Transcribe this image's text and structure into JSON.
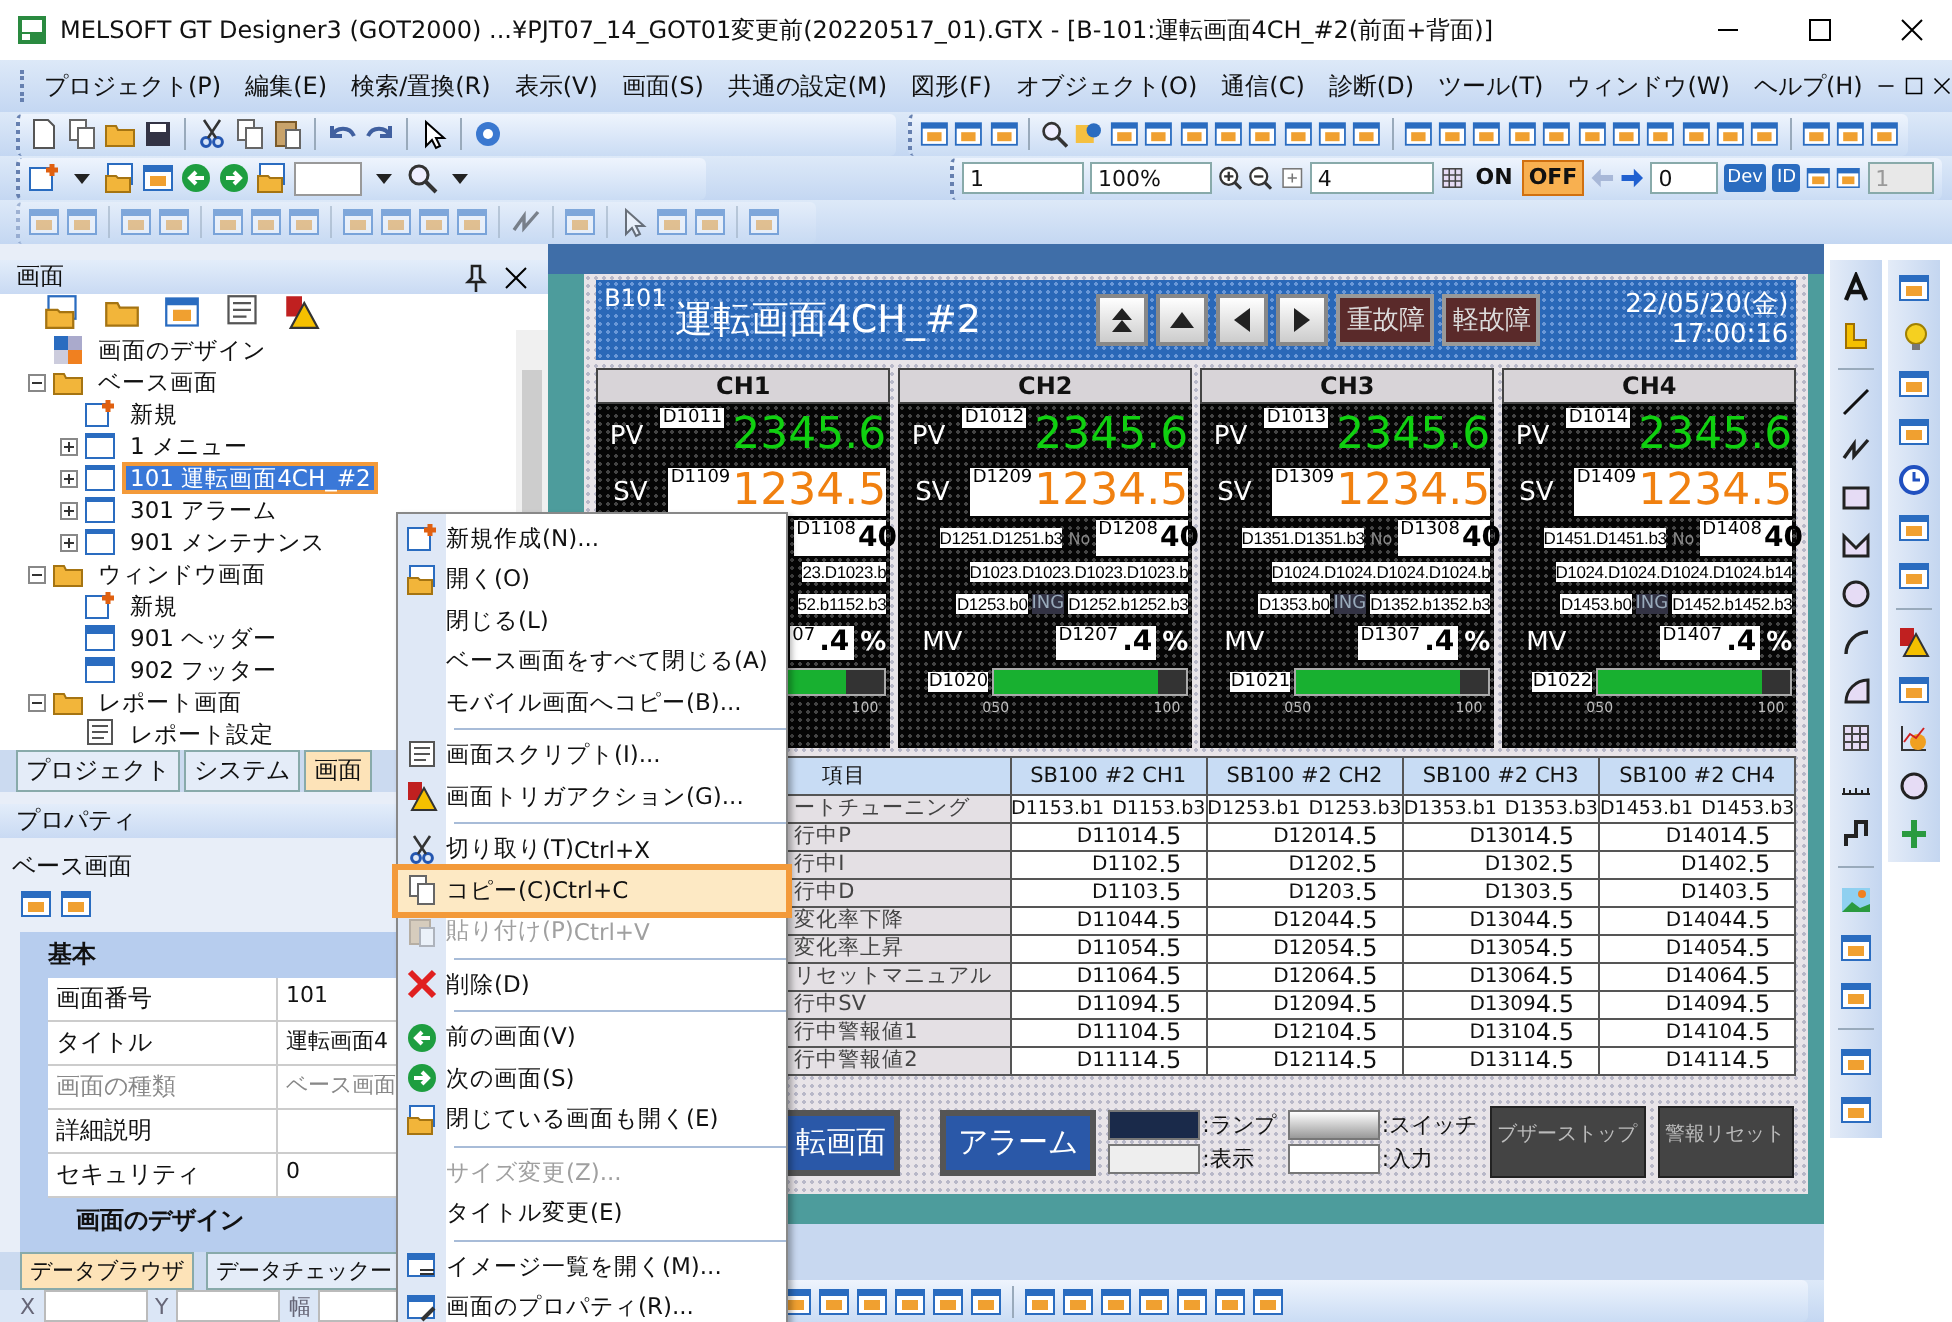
{
  "window": {
    "title": "MELSOFT GT Designer3 (GOT2000) ...¥PJT07_14_GOT01変更前(20220517_01).GTX - [B-101:運転画面4CH_#2(前面+背面)]"
  },
  "menu_bar": [
    "プロジェクト(P)",
    "編集(E)",
    "検索/置換(R)",
    "表示(V)",
    "画面(S)",
    "共通の設定(M)",
    "図形(F)",
    "オブジェクト(O)",
    "通信(C)",
    "診断(D)",
    "ツール(T)",
    "ウィンドウ(W)",
    "ヘルプ(H)"
  ],
  "toolbar_fields": [
    {
      "value": "1",
      "disabled": false
    },
    {
      "value": "100%",
      "disabled": false
    },
    {
      "value": "4",
      "disabled": false
    },
    {
      "value": "0",
      "disabled": false
    },
    {
      "value": "1",
      "disabled": true
    }
  ],
  "toolbar_toggles": [
    {
      "label": "ON",
      "on": false
    },
    {
      "label": "OFF",
      "on": true
    }
  ],
  "toolbar_labels": [
    "Dev",
    "ID"
  ],
  "screen_panel": {
    "title": "画面",
    "tree": [
      {
        "label": "画面のデザイン",
        "kind": "design",
        "selected": false
      },
      {
        "label": "ベース画面",
        "kind": "folder",
        "expanded": true,
        "selected": false,
        "children": [
          {
            "label": "新規",
            "kind": "new",
            "selected": false
          },
          {
            "label": "1 メニュー",
            "kind": "screen",
            "expanded": false,
            "selected": false
          },
          {
            "label": "101 運転画面4CH_#2",
            "kind": "screen",
            "expanded": false,
            "selected": true
          },
          {
            "label": "301 アラーム",
            "kind": "screen",
            "expanded": false,
            "selected": false
          },
          {
            "label": "901 メンテナンス",
            "kind": "screen",
            "expanded": false,
            "selected": false
          }
        ]
      },
      {
        "label": "ウィンドウ画面",
        "kind": "folder",
        "expanded": true,
        "selected": false,
        "children": [
          {
            "label": "新規",
            "kind": "new",
            "selected": false
          },
          {
            "label": "901 ヘッダー",
            "kind": "window",
            "selected": false
          },
          {
            "label": "902 フッター",
            "kind": "window",
            "selected": false
          }
        ]
      },
      {
        "label": "レポート画面",
        "kind": "folder",
        "expanded": true,
        "selected": false,
        "children": [
          {
            "label": "レポート設定",
            "kind": "report",
            "selected": false
          }
        ]
      }
    ],
    "tabs": [
      {
        "label": "プロジェクト",
        "selected": false
      },
      {
        "label": "システム",
        "selected": false
      },
      {
        "label": "画面",
        "selected": true
      }
    ]
  },
  "properties": {
    "title": "プロパティ",
    "object": "ベース画面",
    "section": "基本",
    "rows": [
      {
        "name": "画面番号",
        "value": "101",
        "disabled": false
      },
      {
        "name": "タイトル",
        "value": "運転画面4",
        "disabled": false
      },
      {
        "name": "画面の種類",
        "value": "ベース画面",
        "disabled": true
      },
      {
        "name": "詳細説明",
        "disabled": false
      },
      {
        "name": "セキュリティ",
        "value": "0",
        "disabled": false
      }
    ],
    "subsection": "画面のデザイン"
  },
  "bottom_tabs": [
    {
      "label": "データブラウザ",
      "selected": true
    },
    {
      "label": "データチェックー",
      "selected": false
    }
  ],
  "coordinates": [
    "X",
    "Y",
    "幅"
  ],
  "hmi": {
    "id": "B101",
    "title": "運転画面4CH_#2",
    "alarm_buttons": [
      "重故障",
      "軽故障"
    ],
    "date": "22/05/20(金)",
    "time": "17:00:16",
    "channels": [
      {
        "name": "CH1",
        "pv_label": "PV",
        "pv_device": "D1011",
        "pv_value": "2345.6",
        "sv_label": "SV",
        "sv_device": "D1109",
        "sv_value": "1234.5",
        "step_device": "D1108",
        "step_value": "40",
        "row4": "23.D1023.b",
        "bit_right": "52.b1152.b3",
        "mv_device": "07",
        "mv_value": ".4",
        "mv_unit": "%",
        "level": 0.8,
        "scale": [
          "100"
        ]
      },
      {
        "name": "CH2",
        "pv_label": "PV",
        "pv_device": "D1012",
        "pv_value": "2345.6",
        "sv_label": "SV",
        "sv_device": "D1209",
        "sv_value": "1234.5",
        "bits": "D1251.D1251.b3",
        "no_label": "No",
        "step_device": "D1208",
        "step_value": "40",
        "row4": "D1023.D1023.D1023.D1023.b",
        "bit_left": "D1253.b0",
        "ing": "ING",
        "bit_right": "D1252.b1252.b3",
        "mv_label": "MV",
        "mv_device": "D1207",
        "mv_value": ".4",
        "mv_unit": "%",
        "bar_device": "D1020",
        "level": 0.85,
        "scale": [
          "0",
          "50",
          "100"
        ]
      },
      {
        "name": "CH3",
        "pv_label": "PV",
        "pv_device": "D1013",
        "pv_value": "2345.6",
        "sv_label": "SV",
        "sv_device": "D1309",
        "sv_value": "1234.5",
        "bits": "D1351.D1351.b3",
        "no_label": "No",
        "step_device": "D1308",
        "step_value": "40",
        "row4": "D1024.D1024.D1024.D1024.b",
        "bit_left": "D1353.b0",
        "ing": "ING",
        "bit_right": "D1352.b1352.b3",
        "mv_label": "MV",
        "mv_device": "D1307",
        "mv_value": ".4",
        "mv_unit": "%",
        "bar_device": "D1021",
        "level": 0.85,
        "scale": [
          "0",
          "50",
          "100"
        ]
      },
      {
        "name": "CH4",
        "pv_label": "PV",
        "pv_device": "D1014",
        "pv_value": "2345.6",
        "sv_label": "SV",
        "sv_device": "D1409",
        "sv_value": "1234.5",
        "bits": "D1451.D1451.b3",
        "no_label": "No",
        "step_device": "D1408",
        "step_value": "40",
        "row4": "D1024.D1024.D1024.D1024.b14",
        "bit_left": "D1453.b0",
        "ing": "ING",
        "bit_right": "D1452.b1452.b3",
        "mv_label": "MV",
        "mv_device": "D1407",
        "mv_value": ".4",
        "mv_unit": "%",
        "bar_device": "D1022",
        "level": 0.85,
        "scale": [
          "0",
          "50",
          "100"
        ]
      }
    ],
    "table": {
      "label_header": "項目",
      "columns": [
        "SB100 #2 CH1",
        "SB100 #2 CH2",
        "SB100 #2 CH3",
        "SB100 #2 CH4"
      ],
      "rows": [
        {
          "label": "ートチューニング",
          "kind": "bits",
          "cells": [
            [
              "D1153.b1",
              "D1153.b3"
            ],
            [
              "D1253.b1",
              "D1253.b3"
            ],
            [
              "D1353.b1",
              "D1353.b3"
            ],
            [
              "D1453.b1",
              "D1453.b3"
            ]
          ]
        },
        {
          "label": "行中P",
          "kind": "value",
          "cells": [
            {
              "device": "D1101",
              "value": "4.5"
            },
            {
              "device": "D1201",
              "value": "4.5"
            },
            {
              "device": "D1301",
              "value": "4.5"
            },
            {
              "device": "D1401",
              "value": "4.5"
            }
          ]
        },
        {
          "label": "行中I",
          "kind": "value",
          "cells": [
            {
              "device": "D1102",
              "value": ".5"
            },
            {
              "device": "D1202",
              "value": ".5"
            },
            {
              "device": "D1302",
              "value": ".5"
            },
            {
              "device": "D1402",
              "value": ".5"
            }
          ]
        },
        {
          "label": "行中D",
          "kind": "value",
          "cells": [
            {
              "device": "D1103",
              "value": ".5"
            },
            {
              "device": "D1203",
              "value": ".5"
            },
            {
              "device": "D1303",
              "value": ".5"
            },
            {
              "device": "D1403",
              "value": ".5"
            }
          ]
        },
        {
          "label": "変化率下降",
          "kind": "value",
          "cells": [
            {
              "device": "D1104",
              "value": "4.5"
            },
            {
              "device": "D1204",
              "value": "4.5"
            },
            {
              "device": "D1304",
              "value": "4.5"
            },
            {
              "device": "D1404",
              "value": "4.5"
            }
          ]
        },
        {
          "label": "変化率上昇",
          "kind": "value",
          "cells": [
            {
              "device": "D1105",
              "value": "4.5"
            },
            {
              "device": "D1205",
              "value": "4.5"
            },
            {
              "device": "D1305",
              "value": "4.5"
            },
            {
              "device": "D1405",
              "value": "4.5"
            }
          ]
        },
        {
          "label": "リセットマニュアル",
          "kind": "value",
          "cells": [
            {
              "device": "D1106",
              "value": "4.5"
            },
            {
              "device": "D1206",
              "value": "4.5"
            },
            {
              "device": "D1306",
              "value": "4.5"
            },
            {
              "device": "D1406",
              "value": "4.5"
            }
          ]
        },
        {
          "label": "行中SV",
          "kind": "value",
          "cells": [
            {
              "device": "D1109",
              "value": "4.5"
            },
            {
              "device": "D1209",
              "value": "4.5"
            },
            {
              "device": "D1309",
              "value": "4.5"
            },
            {
              "device": "D1409",
              "value": "4.5"
            }
          ]
        },
        {
          "label": "行中警報値1",
          "kind": "value",
          "cells": [
            {
              "device": "D1110",
              "value": "4.5"
            },
            {
              "device": "D1210",
              "value": "4.5"
            },
            {
              "device": "D1310",
              "value": "4.5"
            },
            {
              "device": "D1410",
              "value": "4.5"
            }
          ]
        },
        {
          "label": "行中警報値2",
          "kind": "value",
          "cells": [
            {
              "device": "D1111",
              "value": "4.5"
            },
            {
              "device": "D1211",
              "value": "4.5"
            },
            {
              "device": "D1311",
              "value": "4.5"
            },
            {
              "device": "D1411",
              "value": "4.5"
            }
          ]
        }
      ]
    },
    "footer": {
      "nav_button": "転画面",
      "alarm_button": "アラーム",
      "legend": [
        {
          "kind": "lamp",
          "label": ":ランプ"
        },
        {
          "kind": "switch",
          "label": ":スイッチ"
        },
        {
          "kind": "display",
          "label": ":表示"
        },
        {
          "kind": "input",
          "label": ":入力"
        }
      ],
      "dim_buttons": [
        "ブザーストップ",
        "警報リセット"
      ]
    }
  },
  "context_menu": [
    {
      "kind": "item",
      "label": "新規作成(N)...",
      "disabled": false,
      "selected": false
    },
    {
      "kind": "item",
      "label": "開く(O)",
      "disabled": false,
      "selected": false
    },
    {
      "kind": "item",
      "label": "閉じる(L)",
      "disabled": false,
      "selected": false
    },
    {
      "kind": "item",
      "label": "ベース画面をすべて閉じる(A)",
      "disabled": false,
      "selected": false
    },
    {
      "kind": "item",
      "label": "モバイル画面へコピー(B)...",
      "disabled": false,
      "selected": false
    },
    {
      "kind": "separator"
    },
    {
      "kind": "item",
      "label": "画面スクリプト(I)...",
      "disabled": false,
      "selected": false
    },
    {
      "kind": "item",
      "label": "画面トリガアクション(G)...",
      "disabled": false,
      "selected": false
    },
    {
      "kind": "separator"
    },
    {
      "kind": "item",
      "label": "切り取り(T)",
      "shortcut": "Ctrl+X",
      "disabled": false,
      "selected": false
    },
    {
      "kind": "item",
      "label": "コピー(C)",
      "shortcut": "Ctrl+C",
      "disabled": false,
      "selected": true
    },
    {
      "kind": "item",
      "label": "貼り付け(P)",
      "shortcut": "Ctrl+V",
      "disabled": true,
      "selected": false
    },
    {
      "kind": "separator"
    },
    {
      "kind": "item",
      "label": "削除(D)",
      "disabled": false,
      "selected": false
    },
    {
      "kind": "separator"
    },
    {
      "kind": "item",
      "label": "前の画面(V)",
      "disabled": false,
      "selected": false
    },
    {
      "kind": "item",
      "label": "次の画面(S)",
      "disabled": false,
      "selected": false
    },
    {
      "kind": "item",
      "label": "閉じている画面も開く(E)",
      "disabled": false,
      "selected": false
    },
    {
      "kind": "separator"
    },
    {
      "kind": "item",
      "label": "サイズ変更(Z)...",
      "disabled": true,
      "selected": false
    },
    {
      "kind": "item",
      "label": "タイトル変更(E)",
      "disabled": false,
      "selected": false
    },
    {
      "kind": "separator"
    },
    {
      "kind": "item",
      "label": "イメージ一覧を開く(M)...",
      "disabled": false,
      "selected": false
    },
    {
      "kind": "item",
      "label": "画面のプロパティ(R)...",
      "disabled": false,
      "selected": false
    }
  ]
}
